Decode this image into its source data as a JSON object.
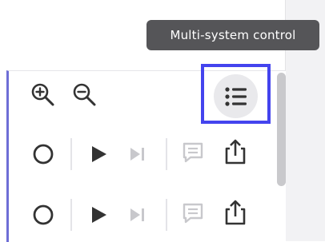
{
  "tooltip": {
    "text": "Multi-system control"
  },
  "toolbar": {
    "zoom_in_icon": "zoom-in-icon",
    "zoom_out_icon": "zoom-out-icon",
    "menu_icon": "list-menu-icon"
  },
  "rows": [
    {
      "icons": [
        "circle-icon",
        "play-icon",
        "skip-next-icon",
        "comment-icon",
        "share-icon"
      ]
    },
    {
      "icons": [
        "circle-icon",
        "play-icon",
        "skip-next-icon",
        "comment-icon",
        "share-icon"
      ]
    }
  ],
  "colors": {
    "accent": "#4444ee",
    "panel_border": "#6e6ed6",
    "tooltip_bg": "#555558",
    "icon_dark": "#333333",
    "icon_muted": "#c8c8cc"
  }
}
